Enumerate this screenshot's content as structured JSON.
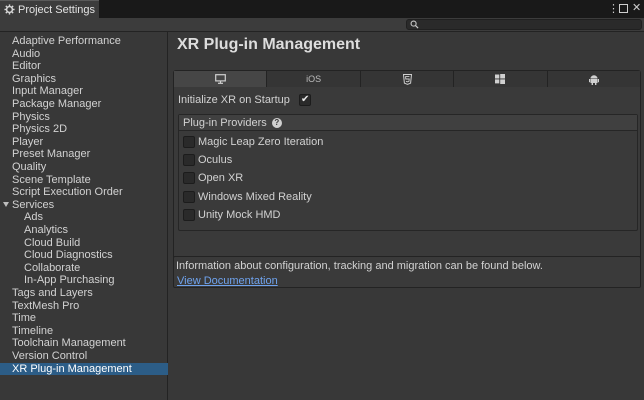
{
  "window": {
    "tab_title": "Project Settings",
    "kebab": "⋮",
    "close": "✕"
  },
  "search": {
    "placeholder": ""
  },
  "sidebar": {
    "items": [
      {
        "label": "Adaptive Performance",
        "level": 0
      },
      {
        "label": "Audio",
        "level": 0
      },
      {
        "label": "Editor",
        "level": 0
      },
      {
        "label": "Graphics",
        "level": 0
      },
      {
        "label": "Input Manager",
        "level": 0
      },
      {
        "label": "Package Manager",
        "level": 0
      },
      {
        "label": "Physics",
        "level": 0
      },
      {
        "label": "Physics 2D",
        "level": 0
      },
      {
        "label": "Player",
        "level": 0
      },
      {
        "label": "Preset Manager",
        "level": 0
      },
      {
        "label": "Quality",
        "level": 0
      },
      {
        "label": "Scene Template",
        "level": 0
      },
      {
        "label": "Script Execution Order",
        "level": 0
      },
      {
        "label": "Services",
        "level": 0,
        "expanded": true
      },
      {
        "label": "Ads",
        "level": 1
      },
      {
        "label": "Analytics",
        "level": 1
      },
      {
        "label": "Cloud Build",
        "level": 1
      },
      {
        "label": "Cloud Diagnostics",
        "level": 1
      },
      {
        "label": "Collaborate",
        "level": 1
      },
      {
        "label": "In-App Purchasing",
        "level": 1
      },
      {
        "label": "Tags and Layers",
        "level": 0
      },
      {
        "label": "TextMesh Pro",
        "level": 0
      },
      {
        "label": "Time",
        "level": 0
      },
      {
        "label": "Timeline",
        "level": 0
      },
      {
        "label": "Toolchain Management",
        "level": 0
      },
      {
        "label": "Version Control",
        "level": 0
      },
      {
        "label": "XR Plug-in Management",
        "level": 0,
        "selected": true
      }
    ]
  },
  "main": {
    "title": "XR Plug-in Management",
    "platform_tabs": [
      {
        "name": "standalone",
        "label": "",
        "icon": "monitor-icon",
        "active": true
      },
      {
        "name": "ios",
        "label": "iOS",
        "icon": "",
        "active": false
      },
      {
        "name": "webgl",
        "label": "",
        "icon": "html5-icon",
        "active": false
      },
      {
        "name": "uwp",
        "label": "",
        "icon": "windows-icon",
        "active": false
      },
      {
        "name": "android",
        "label": "",
        "icon": "android-icon",
        "active": false
      }
    ],
    "init_label": "Initialize XR on Startup",
    "init_checked": true,
    "providers_header": "Plug-in Providers",
    "help_glyph": "?",
    "providers": [
      {
        "label": "Magic Leap Zero Iteration",
        "checked": false
      },
      {
        "label": "Oculus",
        "checked": false
      },
      {
        "label": "Open XR",
        "checked": false
      },
      {
        "label": "Windows Mixed Reality",
        "checked": false
      },
      {
        "label": "Unity Mock HMD",
        "checked": false
      }
    ],
    "info_text": "Information about configuration, tracking and migration can be found below.",
    "info_link": "View Documentation"
  },
  "colors": {
    "selected_bg": "#2c5d87",
    "link": "#6fa3ee",
    "panel_bg": "#383838"
  }
}
